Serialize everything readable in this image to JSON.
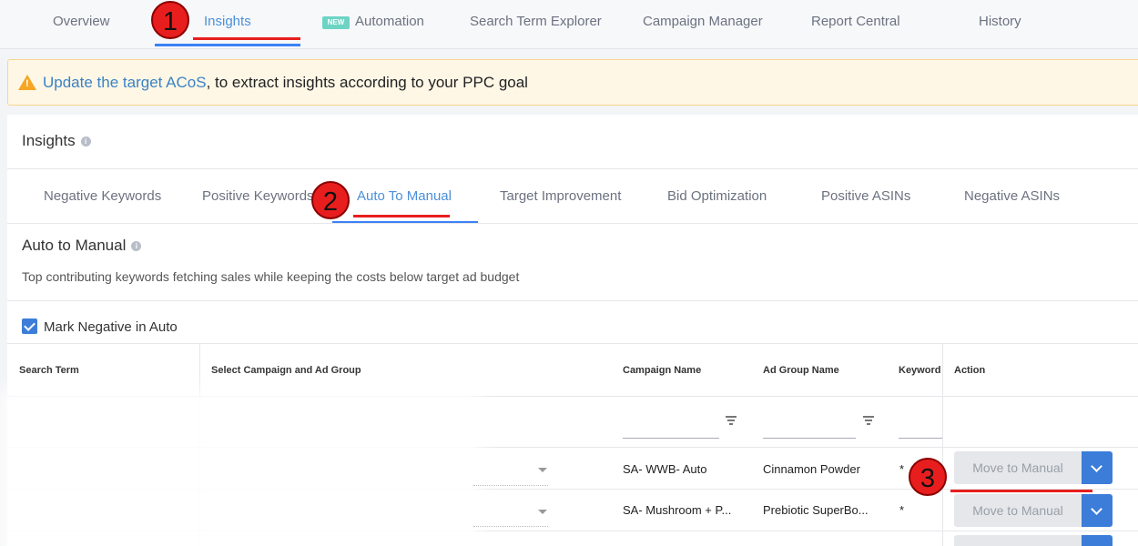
{
  "top_nav": {
    "tabs": [
      {
        "label": "Overview"
      },
      {
        "label": "Insights"
      },
      {
        "label": "Automation",
        "badge": "NEW"
      },
      {
        "label": "Search Term Explorer"
      },
      {
        "label": "Campaign Manager"
      },
      {
        "label": "Report Central"
      },
      {
        "label": "History"
      }
    ],
    "active": "Insights"
  },
  "banner": {
    "link_text": "Update the target ACoS",
    "rest_text": ", to extract insights according to your PPC goal"
  },
  "card": {
    "title": "Insights",
    "subtabs": [
      {
        "label": "Negative Keywords"
      },
      {
        "label": "Positive Keywords"
      },
      {
        "label": "Auto To Manual"
      },
      {
        "label": "Target Improvement"
      },
      {
        "label": "Bid Optimization"
      },
      {
        "label": "Positive ASINs"
      },
      {
        "label": "Negative ASINs"
      }
    ],
    "active_subtab": "Auto To Manual",
    "section_title": "Auto to Manual",
    "section_desc": "Top contributing keywords fetching sales while keeping the costs below target ad budget",
    "checkbox_label": "Mark Negative in Auto",
    "checkbox_checked": true
  },
  "table": {
    "headers": [
      "Search Term",
      "Select Campaign and Ad Group",
      "Campaign Name",
      "Ad Group Name",
      "Keyword",
      "Action"
    ],
    "rows": [
      {
        "campaign": "SA- WWB- Auto",
        "ad_group": "Cinnamon Powder",
        "keyword": "*",
        "action": "Move to Manual"
      },
      {
        "campaign": "SA- Mushroom + P...",
        "ad_group": "Prebiotic SuperBo...",
        "keyword": "*",
        "action": "Move to Manual"
      }
    ]
  },
  "annotations": [
    "1",
    "2",
    "3"
  ],
  "colors": {
    "accent": "#3b7dd8",
    "annotation": "#e81e1e",
    "banner_bg": "#fef7e6",
    "warning": "#f5a623"
  }
}
